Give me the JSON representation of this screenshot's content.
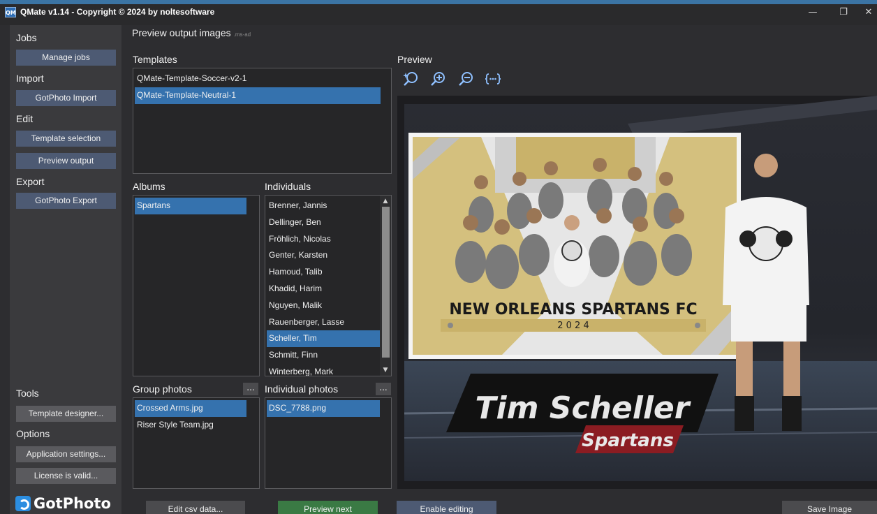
{
  "window": {
    "title": "QMate v1.14 - Copyright © 2024 by noltesoftware",
    "app_icon": "QM",
    "controls": [
      "minimize-icon",
      "restore-icon",
      "close-icon"
    ]
  },
  "sidebar": {
    "sections": {
      "jobs": "Jobs",
      "import": "Import",
      "edit": "Edit",
      "export": "Export",
      "tools": "Tools",
      "options": "Options"
    },
    "buttons": {
      "manage_jobs": "Manage jobs",
      "gotphoto_import": "GotPhoto Import",
      "template_selection": "Template selection",
      "preview_output": "Preview output",
      "gotphoto_export": "GotPhoto Export",
      "template_designer": "Template designer...",
      "application_settings": "Application settings...",
      "license": "License is valid..."
    },
    "logo": "GotPhoto"
  },
  "main": {
    "title": "Preview output images",
    "title_sub": ".ms-ad",
    "templates": {
      "label": "Templates",
      "items": [
        "QMate-Template-Soccer-v2-1",
        "QMate-Template-Neutral-1"
      ],
      "selected_index": 1
    },
    "albums": {
      "label": "Albums",
      "items": [
        "Spartans"
      ],
      "selected_index": 0
    },
    "individuals": {
      "label": "Individuals",
      "items": [
        "Brenner, Jannis",
        "Dellinger, Ben",
        "Fröhlich, Nicolas",
        "Genter, Karsten",
        "Hamoud, Talib",
        "Khadid, Harim",
        "Nguyen, Malik",
        "Rauenberger, Lasse",
        "Scheller, Tim",
        "Schmitt, Finn",
        "Winterberg, Mark"
      ],
      "selected_index": 8
    },
    "group_photos": {
      "label": "Group photos",
      "more_label": "...",
      "items": [
        "Crossed Arms.jpg",
        "Riser Style Team.jpg"
      ],
      "selected_index": 0
    },
    "individual_photos": {
      "label": "Individual photos",
      "more_label": "...",
      "items": [
        "DSC_7788.png"
      ],
      "selected_index": 0
    },
    "preview": {
      "label": "Preview",
      "tools": [
        "zoom-reset-icon",
        "zoom-in-icon",
        "zoom-out-icon",
        "fit-icon"
      ],
      "image": {
        "team_title": "NEW ORLEANS SPARTANS FC",
        "year": "2 0 2 4",
        "player_name": "Tim Scheller",
        "team_name": "Spartans"
      }
    }
  },
  "bottom": {
    "edit_csv": "Edit csv data...",
    "preview_next": "Preview next",
    "enable_editing": "Enable editing",
    "save_image": "Save Image"
  },
  "colors": {
    "accent_blue": "#3572ae",
    "sidebar_button": "#4d5a73",
    "preview_next_green": "#3a7a44",
    "gold": "#c9b26a"
  }
}
